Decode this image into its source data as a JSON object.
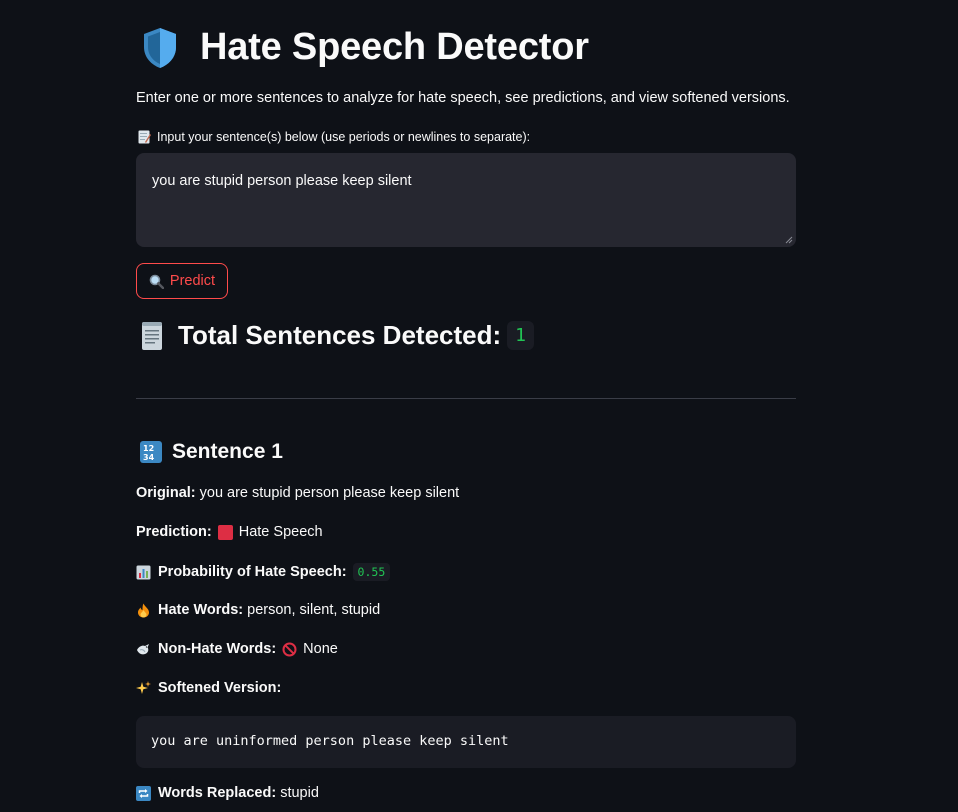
{
  "app": {
    "title": "Hate Speech Detector",
    "subtitle": "Enter one or more sentences to analyze for hate speech, see predictions, and view softened versions.",
    "shield_icon": "shield-icon"
  },
  "input": {
    "label": "Input your sentence(s) below (use periods or newlines to separate):",
    "value": "you are stupid person please keep silent"
  },
  "predict_button": {
    "label": "Predict",
    "icon": "magnifier-icon",
    "color": "#ff4b4b"
  },
  "summary": {
    "label": "Total Sentences Detected:",
    "count": "1"
  },
  "sentence": {
    "heading": "Sentence 1",
    "original_label": "Original:",
    "original_value": "you are stupid person please keep silent",
    "prediction_label": "Prediction:",
    "prediction_value": "Hate Speech",
    "probability_label": "Probability of Hate Speech:",
    "probability_value": "0.55",
    "hate_words_label": "Hate Words:",
    "hate_words_value": "person, silent, stupid",
    "non_hate_words_label": "Non-Hate Words:",
    "non_hate_words_value": "None",
    "softened_label": "Softened Version:",
    "softened_value": "you are uninformed person please keep silent",
    "replaced_label": "Words Replaced:",
    "replaced_value": "stupid"
  },
  "colors": {
    "background": "#0e1117",
    "accent": "#ff4b4b",
    "badge_text": "#21c354",
    "input_bg": "#262730",
    "hate_square": "#dd2e44"
  }
}
